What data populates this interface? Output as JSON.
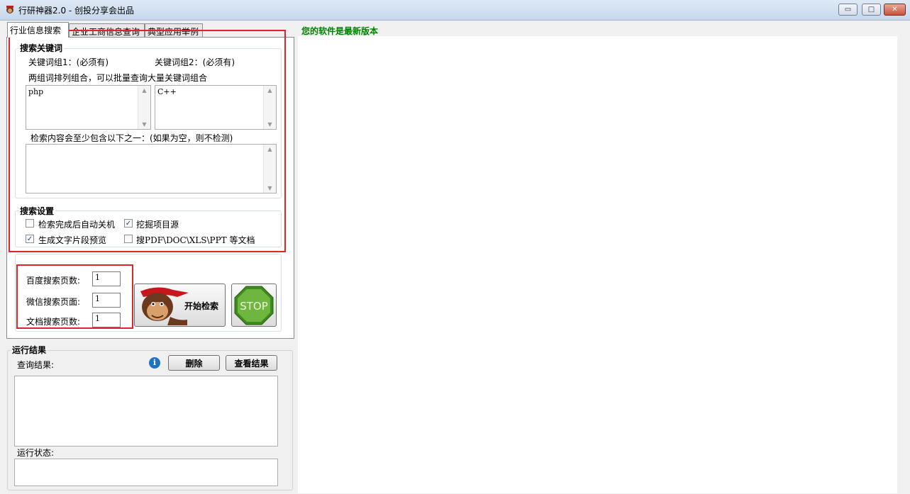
{
  "window": {
    "title": "行研神器2.0 - 创投分享会出品",
    "controls": {
      "minimize": "▭",
      "maximize": "□",
      "close": "✕"
    }
  },
  "tabs": [
    {
      "label": "行业信息搜索",
      "active": true
    },
    {
      "label": "企业工商信息查询",
      "active": false
    },
    {
      "label": "典型应用举例",
      "active": false
    }
  ],
  "keywords": {
    "group_title": "搜索关键词",
    "group1_label": "关键词组1：(必须有)",
    "group2_label": "关键词组2：(必须有)",
    "hint": "两组词排列组合，可以批量查询大量关键词组合",
    "group1_value": "php",
    "group2_value": "C++",
    "filter_label": "检索内容会至少包含以下之一：(如果为空，则不检测)",
    "filter_value": ""
  },
  "settings": {
    "group_title": "搜索设置",
    "options": [
      {
        "label": "检索完成后自动关机",
        "checked": false
      },
      {
        "label": "挖掘项目源",
        "checked": true
      },
      {
        "label": "生成文字片段预览",
        "checked": true
      },
      {
        "label": "搜PDF\\DOC\\XLS\\PPT 等文档",
        "checked": false
      }
    ]
  },
  "pages": {
    "baidu_label": "百度搜索页数:",
    "baidu_value": "1",
    "wechat_label": "微信搜索页面:",
    "wechat_value": "1",
    "doc_label": "文档搜索页数:",
    "doc_value": "1"
  },
  "actions": {
    "start_label": "开始检索",
    "stop_label": "STOP"
  },
  "results": {
    "group_title": "运行结果",
    "query_label": "查询结果:",
    "delete_label": "删除",
    "view_label": "查看结果",
    "info_icon": "i",
    "status_label": "运行状态:"
  },
  "status": {
    "version_text": "您的软件是最新版本",
    "version_color": "#008000"
  },
  "colors": {
    "highlight_red": "#e1232a",
    "checkmark": "#21448c"
  }
}
